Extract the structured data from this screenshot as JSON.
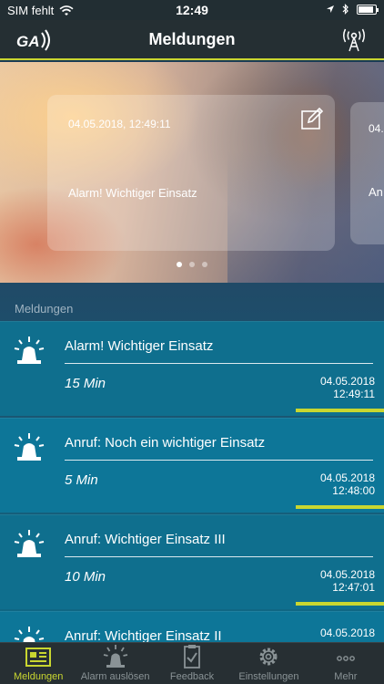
{
  "status": {
    "carrier": "SIM fehlt",
    "time": "12:49",
    "battery_level": 0.9
  },
  "header": {
    "title": "Meldungen",
    "logo_icon": "ga-logo-icon",
    "right_icon": "antenna-broadcast-icon"
  },
  "hero": {
    "cards": [
      {
        "date": "04.05.2018, 12:49:11",
        "title": "Alarm! Wichtiger Einsatz",
        "icon": "edit-icon"
      },
      {
        "date": "04.",
        "title": "An"
      }
    ],
    "page_count": 3,
    "active_page": 0
  },
  "list": {
    "section_label": "Meldungen",
    "items": [
      {
        "title": "Alarm! Wichtiger Einsatz",
        "ago": "15 Min",
        "date": "04.05.2018",
        "time": "12:49:11"
      },
      {
        "title": "Anruf: Noch ein wichtiger Einsatz",
        "ago": "5 Min",
        "date": "04.05.2018",
        "time": "12:48:00"
      },
      {
        "title": "Anruf: Wichtiger Einsatz III",
        "ago": "10 Min",
        "date": "04.05.2018",
        "time": "12:47:01"
      },
      {
        "title": "Anruf: Wichtiger Einsatz II",
        "ago": "",
        "date": "04.05.2018",
        "time": ""
      }
    ]
  },
  "tabs": [
    {
      "label": "Meldungen",
      "icon": "news-icon",
      "active": true
    },
    {
      "label": "Alarm auslösen",
      "icon": "siren-icon",
      "active": false
    },
    {
      "label": "Feedback",
      "icon": "clipboard-check-icon",
      "active": false
    },
    {
      "label": "Einstellungen",
      "icon": "gear-icon",
      "active": false
    },
    {
      "label": "Mehr",
      "icon": "more-icon",
      "active": false
    }
  ],
  "colors": {
    "accent": "#c9d630",
    "header_bg": "#252f33",
    "list_bg": "#0f6f8e"
  }
}
